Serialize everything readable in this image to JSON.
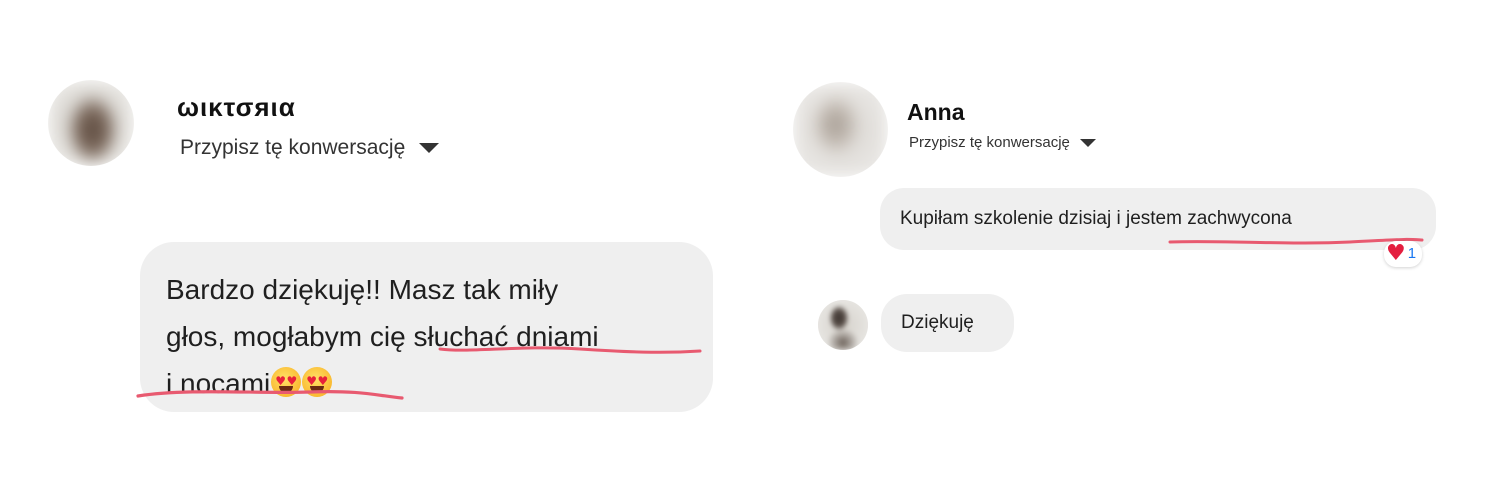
{
  "left_conversation": {
    "contact_name": "ωικτσяια",
    "assign_label": "Przypisz tę konwersację",
    "message": {
      "line1": "Bardzo dziękuję!! Masz tak miły",
      "line2_a": "głos, mogłabym cię ",
      "line2_b": "słuchać dniami",
      "line3": "i nocami"
    },
    "emoji_names": [
      "smiling-face-with-heart-eyes-icon",
      "smiling-face-with-heart-eyes-icon"
    ],
    "underline_color": "#e85a70"
  },
  "right_conversation": {
    "contact_name": "Anna",
    "assign_label": "Przypisz tę konwersację",
    "incoming_message": "Kupiłam szkolenie dzisiaj i jestem zachwycona",
    "reaction": {
      "icon": "heart-icon",
      "count": "1"
    },
    "reply_message": "Dziękuję",
    "underline_color": "#e85a70"
  },
  "colors": {
    "bubble_bg": "#efefef",
    "reaction_heart": "#e41e3f",
    "reaction_count": "#1877f2"
  }
}
